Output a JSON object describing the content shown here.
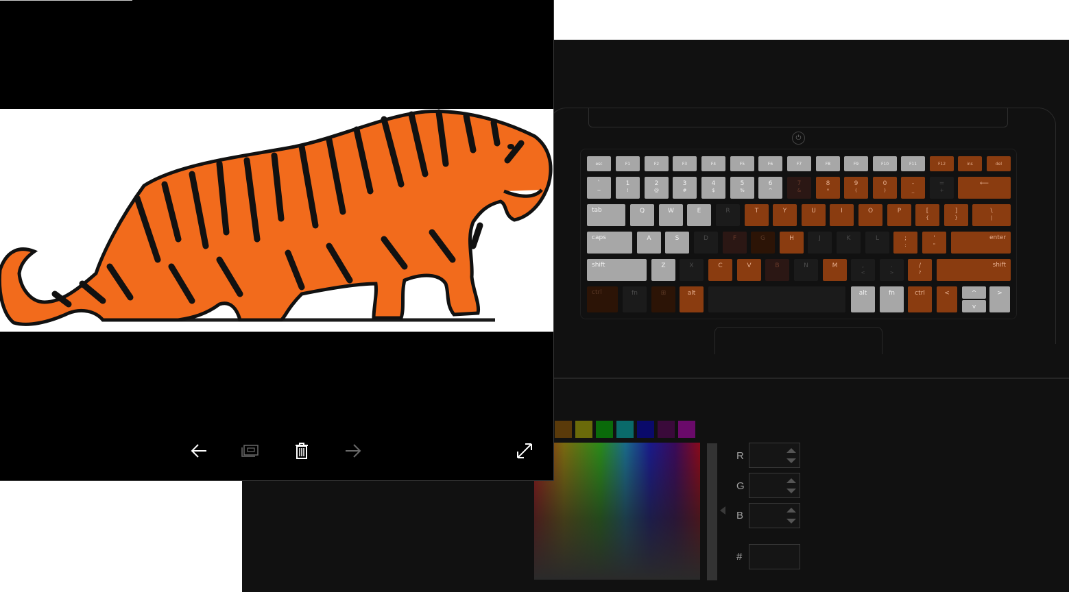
{
  "photo_viewer": {
    "image_name": "tiger-illustration",
    "toolbar": {
      "previous_icon": "arrow-left-icon",
      "slideshow_icon": "slideshow-icon",
      "delete_icon": "trash-icon",
      "next_icon": "arrow-right-icon",
      "fullscreen_icon": "expand-icon"
    }
  },
  "keyboard": {
    "rows": [
      [
        {
          "label": "esc",
          "state": "grey"
        },
        {
          "label": "F1",
          "state": "grey"
        },
        {
          "label": "F2",
          "state": "grey"
        },
        {
          "label": "F3",
          "state": "grey"
        },
        {
          "label": "F4",
          "state": "grey"
        },
        {
          "label": "F5",
          "state": "grey"
        },
        {
          "label": "F6",
          "state": "grey"
        },
        {
          "label": "F7",
          "state": "grey"
        },
        {
          "label": "F8",
          "state": "grey"
        },
        {
          "label": "F9",
          "state": "grey"
        },
        {
          "label": "F10",
          "state": "grey"
        },
        {
          "label": "F11",
          "state": "grey"
        },
        {
          "label": "F12",
          "state": "orange"
        },
        {
          "label": "ins",
          "state": "orange"
        },
        {
          "label": "del",
          "state": "orange"
        }
      ],
      [
        {
          "label": "`",
          "sub": "~",
          "state": "grey"
        },
        {
          "label": "1",
          "sub": "!",
          "state": "grey"
        },
        {
          "label": "2",
          "sub": "@",
          "state": "grey"
        },
        {
          "label": "3",
          "sub": "#",
          "state": "grey"
        },
        {
          "label": "4",
          "sub": "$",
          "state": "grey"
        },
        {
          "label": "5",
          "sub": "%",
          "state": "grey"
        },
        {
          "label": "6",
          "sub": "^",
          "state": "grey"
        },
        {
          "label": "7",
          "sub": "&",
          "state": "brown"
        },
        {
          "label": "8",
          "sub": "*",
          "state": "orange"
        },
        {
          "label": "9",
          "sub": "(",
          "state": "orange"
        },
        {
          "label": "0",
          "sub": ")",
          "state": "orange"
        },
        {
          "label": "-",
          "sub": "_",
          "state": "orange"
        },
        {
          "label": "=",
          "sub": "+",
          "state": "dark"
        },
        {
          "label": "⟵",
          "state": "orange"
        }
      ],
      [
        {
          "label": "tab",
          "state": "grey"
        },
        {
          "label": "Q",
          "state": "grey"
        },
        {
          "label": "W",
          "state": "grey"
        },
        {
          "label": "E",
          "state": "grey"
        },
        {
          "label": "R",
          "state": "dark"
        },
        {
          "label": "T",
          "state": "orange"
        },
        {
          "label": "Y",
          "state": "orange"
        },
        {
          "label": "U",
          "state": "orange"
        },
        {
          "label": "I",
          "state": "orange"
        },
        {
          "label": "O",
          "state": "orange"
        },
        {
          "label": "P",
          "state": "orange"
        },
        {
          "label": "[",
          "sub": "{",
          "state": "orange"
        },
        {
          "label": "]",
          "sub": "}",
          "state": "orange"
        },
        {
          "label": "\\",
          "sub": "|",
          "state": "orange"
        }
      ],
      [
        {
          "label": "caps",
          "state": "grey"
        },
        {
          "label": "A",
          "state": "grey"
        },
        {
          "label": "S",
          "state": "grey"
        },
        {
          "label": "D",
          "state": "dark"
        },
        {
          "label": "F",
          "state": "brown"
        },
        {
          "label": "G",
          "state": "darkbrown"
        },
        {
          "label": "H",
          "state": "orange"
        },
        {
          "label": "J",
          "state": "dark"
        },
        {
          "label": "K",
          "state": "dark"
        },
        {
          "label": "L",
          "state": "dark"
        },
        {
          "label": ";",
          "sub": ":",
          "state": "orange"
        },
        {
          "label": "'",
          "sub": "\"",
          "state": "orange"
        },
        {
          "label": "enter",
          "state": "orange"
        }
      ],
      [
        {
          "label": "shift",
          "state": "grey"
        },
        {
          "label": "Z",
          "state": "grey"
        },
        {
          "label": "X",
          "state": "dark"
        },
        {
          "label": "C",
          "state": "orange"
        },
        {
          "label": "V",
          "state": "orange"
        },
        {
          "label": "B",
          "state": "brown"
        },
        {
          "label": "N",
          "state": "dark"
        },
        {
          "label": "M",
          "state": "orange"
        },
        {
          "label": ",",
          "sub": "<",
          "state": "dark"
        },
        {
          "label": ".",
          "sub": ">",
          "state": "dark"
        },
        {
          "label": "/",
          "sub": "?",
          "state": "orange"
        },
        {
          "label": "shift",
          "state": "orange"
        }
      ],
      [
        {
          "label": "ctrl",
          "state": "darkbrown"
        },
        {
          "label": "fn",
          "state": "dark"
        },
        {
          "label": "",
          "state": "darkbrown"
        },
        {
          "label": "alt",
          "state": "orange"
        },
        {
          "label": "",
          "state": "dark"
        },
        {
          "label": "alt",
          "state": "grey"
        },
        {
          "label": "fn",
          "state": "grey"
        },
        {
          "label": "ctrl",
          "state": "orange"
        },
        {
          "label": "<",
          "state": "orange"
        },
        {
          "label": "^",
          "state": "grey"
        },
        {
          "label": "v",
          "state": "grey"
        },
        {
          "label": ">",
          "state": "grey"
        }
      ]
    ]
  },
  "palette": {
    "swatches": [
      "#5a3a0a",
      "#6a6a0a",
      "#0a6a0a",
      "#0a6a6a",
      "#0a0a6a",
      "#3a0a3a",
      "#6a0a6a"
    ]
  },
  "color_picker": {
    "r_label": "R",
    "g_label": "G",
    "b_label": "B",
    "hex_label": "#",
    "r_value": "",
    "g_value": "",
    "b_value": "",
    "hex_value": ""
  }
}
